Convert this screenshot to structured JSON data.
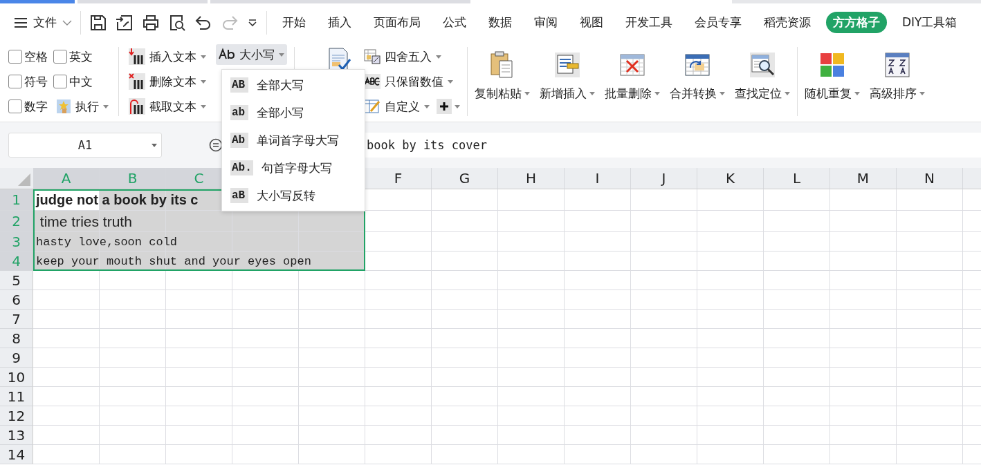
{
  "menu": {
    "file_label": "文件",
    "quick_tools": [
      {
        "kind": "save",
        "disabled": false
      },
      {
        "kind": "export",
        "disabled": false
      },
      {
        "kind": "print",
        "disabled": false
      },
      {
        "kind": "preview",
        "disabled": false
      },
      {
        "kind": "undo",
        "disabled": false
      },
      {
        "kind": "redo",
        "disabled": true
      },
      {
        "kind": "more",
        "disabled": false
      }
    ],
    "tabs": [
      {
        "label": "开始",
        "selected": false
      },
      {
        "label": "插入",
        "selected": false
      },
      {
        "label": "页面布局",
        "selected": false
      },
      {
        "label": "公式",
        "selected": false
      },
      {
        "label": "数据",
        "selected": false
      },
      {
        "label": "审阅",
        "selected": false
      },
      {
        "label": "视图",
        "selected": false
      },
      {
        "label": "开发工具",
        "selected": false
      },
      {
        "label": "会员专享",
        "selected": false
      },
      {
        "label": "稻壳资源",
        "selected": false
      },
      {
        "label": "方方格子",
        "selected": true
      },
      {
        "label": "DIY工具箱",
        "selected": false
      }
    ]
  },
  "ribbon": {
    "checkboxes": [
      {
        "label": "空格",
        "checked": false
      },
      {
        "label": "英文",
        "checked": false
      },
      {
        "label": "符号",
        "checked": false
      },
      {
        "label": "中文",
        "checked": false
      },
      {
        "label": "数字",
        "checked": false
      }
    ],
    "execute": "执行",
    "text_tools": [
      {
        "kind": "insert",
        "label": "插入文本"
      },
      {
        "kind": "delete",
        "label": "删除文本"
      },
      {
        "kind": "cut",
        "label": "截取文本"
      }
    ],
    "case_button": {
      "label": "大小写",
      "pressed": true
    },
    "number_tools": [
      {
        "kind": "round",
        "label": "四舍五入"
      },
      {
        "kind": "values",
        "label": "只保留数值"
      },
      {
        "kind": "custom",
        "label": "自定义"
      }
    ],
    "big_groups": [
      [
        {
          "kind": "paste",
          "label": "复制粘贴"
        },
        {
          "kind": "insert",
          "label": "新增插入"
        },
        {
          "kind": "delete",
          "label": "批量删除"
        },
        {
          "kind": "merge",
          "label": "合并转换"
        },
        {
          "kind": "find",
          "label": "查找定位"
        }
      ],
      [
        {
          "kind": "random",
          "label": "随机重复"
        },
        {
          "kind": "sort",
          "label": "高级排序"
        }
      ]
    ]
  },
  "case_menu": [
    {
      "badge": "AB",
      "label": "全部大写"
    },
    {
      "badge": "ab",
      "label": "全部小写"
    },
    {
      "badge": "Ab",
      "label": "单词首字母大写"
    },
    {
      "badge": "Ab.",
      "label": "句首字母大写"
    },
    {
      "badge": "aB",
      "label": "大小写反转"
    }
  ],
  "formula_bar": {
    "name_box": "A1",
    "formula": "book by its cover"
  },
  "sheet": {
    "columns": [
      {
        "label": "A",
        "selected": true
      },
      {
        "label": "B",
        "selected": true
      },
      {
        "label": "C",
        "selected": true
      },
      {
        "label": "F",
        "selected": false
      },
      {
        "label": "G",
        "selected": false
      },
      {
        "label": "H",
        "selected": false
      },
      {
        "label": "I",
        "selected": false
      },
      {
        "label": "J",
        "selected": false
      },
      {
        "label": "K",
        "selected": false
      },
      {
        "label": "L",
        "selected": false
      },
      {
        "label": "M",
        "selected": false
      },
      {
        "label": "N",
        "selected": false
      }
    ],
    "rows": [
      {
        "label": "1",
        "selected": true,
        "active": true,
        "kind": "bold",
        "text": "judge not a book by its c"
      },
      {
        "label": "2",
        "selected": true,
        "active": false,
        "kind": "sans",
        "text": " time tries truth"
      },
      {
        "label": "3",
        "selected": true,
        "active": false,
        "kind": "mono",
        "text": "hasty love,soon cold"
      },
      {
        "label": "4",
        "selected": true,
        "active": false,
        "kind": "mono",
        "text": "keep your mouth shut and your eyes open"
      },
      {
        "label": "5",
        "selected": false,
        "active": false
      },
      {
        "label": "6",
        "selected": false,
        "active": false
      },
      {
        "label": "7",
        "selected": false,
        "active": false
      },
      {
        "label": "8",
        "selected": false,
        "active": false
      },
      {
        "label": "9",
        "selected": false,
        "active": false
      },
      {
        "label": "10",
        "selected": false,
        "active": false
      },
      {
        "label": "11",
        "selected": false,
        "active": false
      },
      {
        "label": "12",
        "selected": false,
        "active": false
      },
      {
        "label": "13",
        "selected": false,
        "active": false
      },
      {
        "label": "14",
        "selected": false,
        "active": false
      }
    ]
  }
}
